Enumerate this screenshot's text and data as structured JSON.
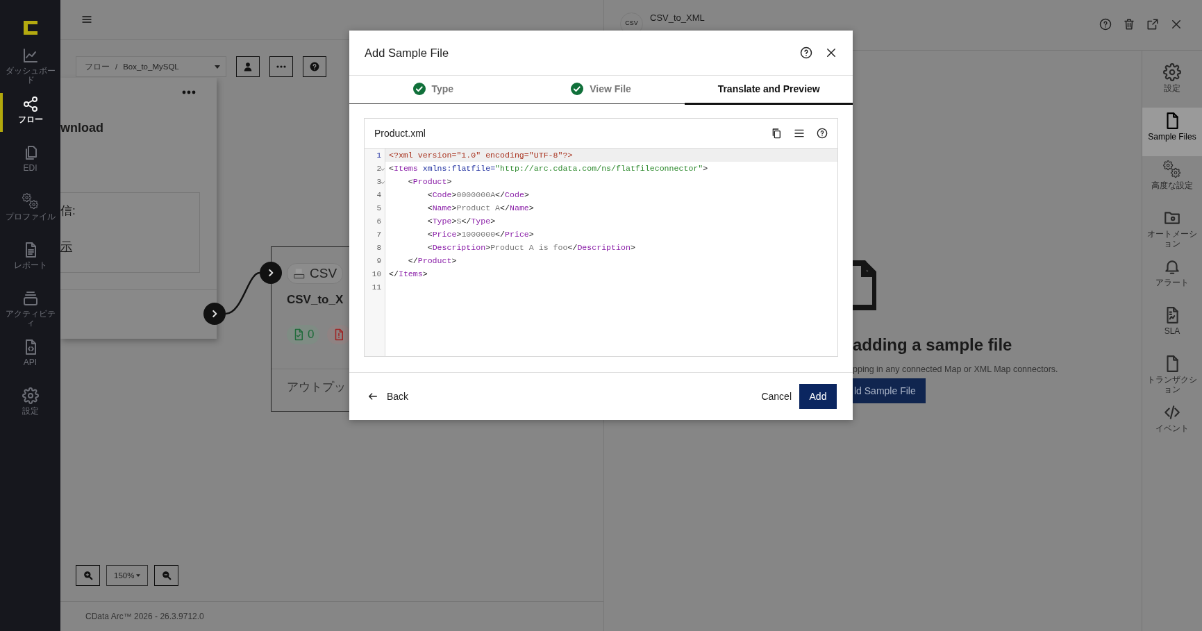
{
  "nav": {
    "items": [
      {
        "label": "ダッシュボード",
        "selected": false
      },
      {
        "label": "フロー",
        "selected": true
      },
      {
        "label": "EDI",
        "selected": false
      },
      {
        "label": "プロファイル",
        "selected": false
      },
      {
        "label": "レポート",
        "selected": false
      },
      {
        "label": "アクティビティ",
        "selected": false
      },
      {
        "label": "API",
        "selected": false
      },
      {
        "label": "設定",
        "selected": false
      }
    ]
  },
  "canvas": {
    "breadcrumb": {
      "root": "フロー",
      "separator": "/",
      "flow": "Box_to_MySQL"
    },
    "zoom": "150%",
    "left_node": {
      "title": "wnload",
      "received_label": "信:",
      "link": "示"
    },
    "right_node": {
      "type_badge": "CSV",
      "title": "CSV_to_X",
      "success_count": "0",
      "output_label": "アウトプッ"
    }
  },
  "footer": "CData Arc™ 2026 - 26.3.9712.0",
  "panel": {
    "avatar_text": "CSV",
    "title": "CSV_to_XML",
    "empty_heading": "adding a sample file",
    "empty_text": "pping in any connected Map or XML Map connectors.",
    "empty_button": "ld Sample File",
    "rail": [
      {
        "label": "設定",
        "selected": false
      },
      {
        "label": "Sample Files",
        "selected": true
      },
      {
        "label": "高度な設定",
        "selected": false
      },
      {
        "label": "オートメーション",
        "selected": false
      },
      {
        "label": "アラート",
        "selected": false
      },
      {
        "label": "SLA",
        "selected": false
      },
      {
        "label": "トランザクション",
        "selected": false
      },
      {
        "label": "イベント",
        "selected": false
      }
    ]
  },
  "modal": {
    "title": "Add Sample File",
    "tabs": [
      {
        "label": "Type",
        "done": true,
        "selected": false
      },
      {
        "label": "View File",
        "done": true,
        "selected": false
      },
      {
        "label": "Translate and Preview",
        "done": false,
        "selected": true
      }
    ],
    "file_name": "Product.xml",
    "lines": [
      {
        "number": "1",
        "current": true,
        "fold": false,
        "tokens": [
          {
            "kind": "decl",
            "text": "<?xml version=\"1.0\" encoding=\"UTF-8\"?>"
          }
        ]
      },
      {
        "number": "2",
        "current": false,
        "fold": true,
        "tokens": [
          {
            "kind": "punct",
            "text": "<"
          },
          {
            "kind": "tag",
            "text": "Items"
          },
          {
            "kind": "attr",
            "text": " xmlns:flatfile="
          },
          {
            "kind": "str",
            "text": "\"http://arc.cdata.com/ns/flatfileconnector\""
          },
          {
            "kind": "punct",
            "text": ">"
          }
        ]
      },
      {
        "number": "3",
        "current": false,
        "fold": true,
        "tokens": [
          {
            "kind": "punct",
            "text": "    <"
          },
          {
            "kind": "tag",
            "text": "Product"
          },
          {
            "kind": "punct",
            "text": ">"
          }
        ]
      },
      {
        "number": "4",
        "current": false,
        "fold": false,
        "tokens": [
          {
            "kind": "punct",
            "text": "        <"
          },
          {
            "kind": "tag",
            "text": "Code"
          },
          {
            "kind": "punct",
            "text": ">"
          },
          {
            "kind": "text",
            "text": "0000000A"
          },
          {
            "kind": "punct",
            "text": "</"
          },
          {
            "kind": "tag",
            "text": "Code"
          },
          {
            "kind": "punct",
            "text": ">"
          }
        ]
      },
      {
        "number": "5",
        "current": false,
        "fold": false,
        "tokens": [
          {
            "kind": "punct",
            "text": "        <"
          },
          {
            "kind": "tag",
            "text": "Name"
          },
          {
            "kind": "punct",
            "text": ">"
          },
          {
            "kind": "text",
            "text": "Product A"
          },
          {
            "kind": "punct",
            "text": "</"
          },
          {
            "kind": "tag",
            "text": "Name"
          },
          {
            "kind": "punct",
            "text": ">"
          }
        ]
      },
      {
        "number": "6",
        "current": false,
        "fold": false,
        "tokens": [
          {
            "kind": "punct",
            "text": "        <"
          },
          {
            "kind": "tag",
            "text": "Type"
          },
          {
            "kind": "punct",
            "text": ">"
          },
          {
            "kind": "text",
            "text": "S"
          },
          {
            "kind": "punct",
            "text": "</"
          },
          {
            "kind": "tag",
            "text": "Type"
          },
          {
            "kind": "punct",
            "text": ">"
          }
        ]
      },
      {
        "number": "7",
        "current": false,
        "fold": false,
        "tokens": [
          {
            "kind": "punct",
            "text": "        <"
          },
          {
            "kind": "tag",
            "text": "Price"
          },
          {
            "kind": "punct",
            "text": ">"
          },
          {
            "kind": "text",
            "text": "1000000"
          },
          {
            "kind": "punct",
            "text": "</"
          },
          {
            "kind": "tag",
            "text": "Price"
          },
          {
            "kind": "punct",
            "text": ">"
          }
        ]
      },
      {
        "number": "8",
        "current": false,
        "fold": false,
        "tokens": [
          {
            "kind": "punct",
            "text": "        <"
          },
          {
            "kind": "tag",
            "text": "Description"
          },
          {
            "kind": "punct",
            "text": ">"
          },
          {
            "kind": "text",
            "text": "Product A is foo"
          },
          {
            "kind": "punct",
            "text": "</"
          },
          {
            "kind": "tag",
            "text": "Description"
          },
          {
            "kind": "punct",
            "text": ">"
          }
        ]
      },
      {
        "number": "9",
        "current": false,
        "fold": false,
        "tokens": [
          {
            "kind": "punct",
            "text": "    </"
          },
          {
            "kind": "tag",
            "text": "Product"
          },
          {
            "kind": "punct",
            "text": ">"
          }
        ]
      },
      {
        "number": "10",
        "current": false,
        "fold": false,
        "tokens": [
          {
            "kind": "punct",
            "text": "</"
          },
          {
            "kind": "tag",
            "text": "Items"
          },
          {
            "kind": "punct",
            "text": ">"
          }
        ]
      },
      {
        "number": "11",
        "current": false,
        "fold": false
      }
    ],
    "back": "Back",
    "cancel": "Cancel",
    "add": "Add"
  }
}
